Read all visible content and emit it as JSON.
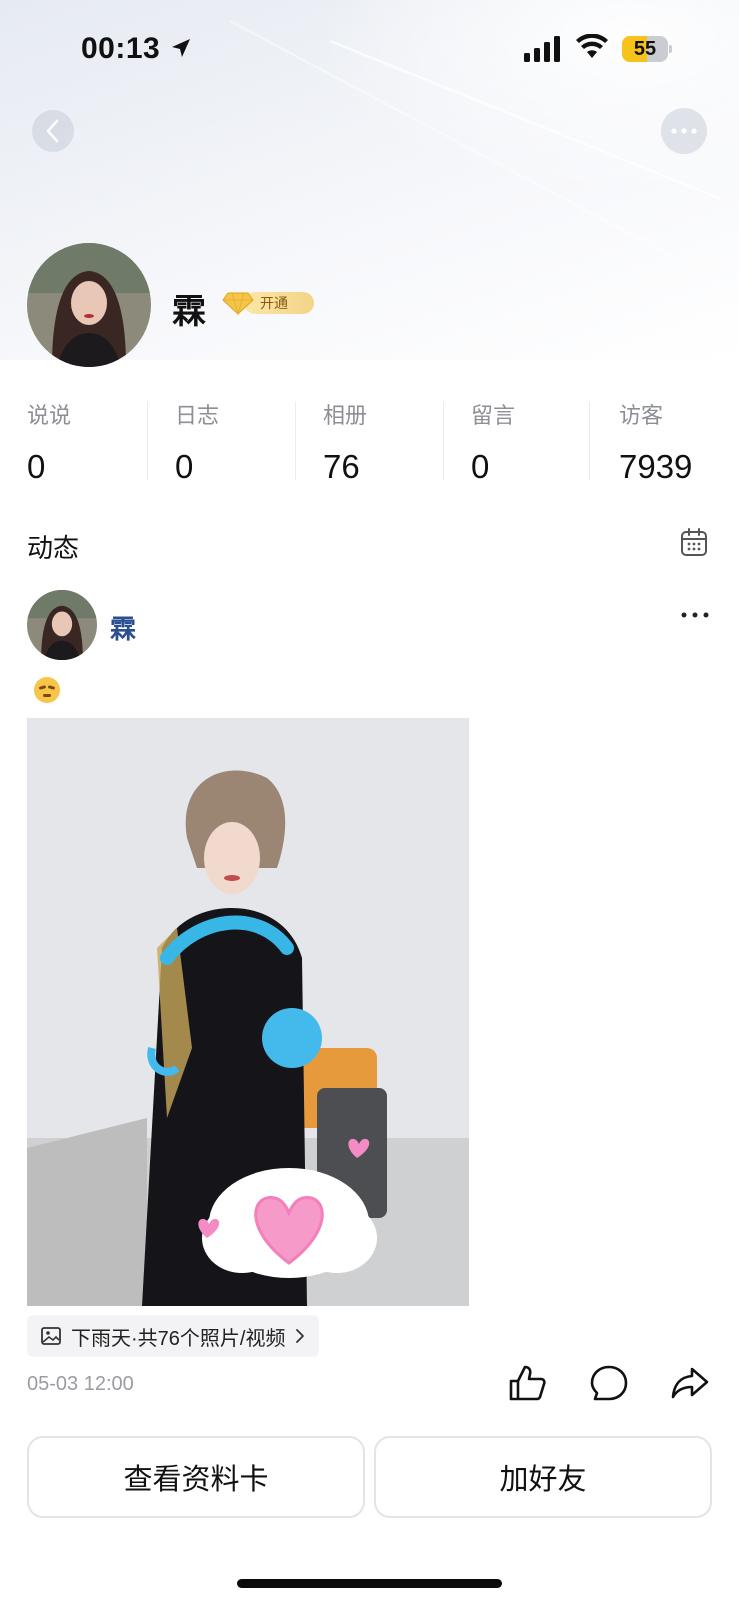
{
  "status_bar": {
    "time": "00:13",
    "battery": "55",
    "battery_level": 0.55
  },
  "profile": {
    "name": "霖",
    "vip_label": "开通"
  },
  "stats": [
    {
      "label": "说说",
      "value": "0"
    },
    {
      "label": "日志",
      "value": "0"
    },
    {
      "label": "相册",
      "value": "76"
    },
    {
      "label": "留言",
      "value": "0"
    },
    {
      "label": "访客",
      "value": "7939"
    }
  ],
  "feed": {
    "title": "动态",
    "post": {
      "author": "霖",
      "album_tag": "下雨天·共76个照片/视频",
      "time": "05-03 12:00"
    }
  },
  "actions": {
    "view_profile": "查看资料卡",
    "add_friend": "加好友"
  },
  "colors": {
    "accent_name": "#2c4f8f",
    "battery": "#f7c21a",
    "vip_gold": "#f3c64a"
  },
  "icons": [
    "location-arrow-icon",
    "cellular-signal-icon",
    "wifi-icon",
    "battery-icon",
    "back-chevron-icon",
    "more-dots-icon",
    "diamond-icon",
    "calendar-icon",
    "emoji-icon",
    "image-icon",
    "chevron-right-icon",
    "thumb-up-icon",
    "comment-icon",
    "share-icon"
  ]
}
